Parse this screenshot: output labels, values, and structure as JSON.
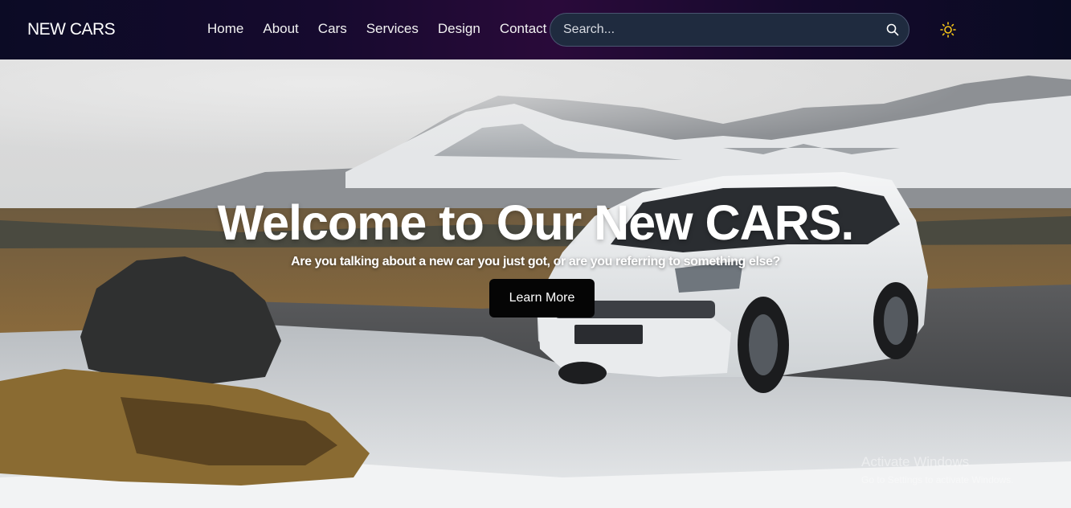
{
  "brand": {
    "logo": "NEW CARS"
  },
  "nav": {
    "items": [
      {
        "label": "Home"
      },
      {
        "label": "About"
      },
      {
        "label": "Cars"
      },
      {
        "label": "Services"
      },
      {
        "label": "Design"
      },
      {
        "label": "Contact"
      }
    ]
  },
  "search": {
    "placeholder": "Search...",
    "icon": "search-icon"
  },
  "theme_toggle": {
    "icon": "sun-icon",
    "color": "#f5c518"
  },
  "hero": {
    "title": "Welcome to Our New CARS.",
    "subtitle": "Are you talking about a new car you just got, or are you referring to something else?",
    "cta_label": "Learn More",
    "background": "photo of a white SUV parked on an icy road with snowy mountains behind"
  },
  "os_watermark": {
    "title": "Activate Windows",
    "subtitle": "Go to Settings to activate Windows."
  }
}
